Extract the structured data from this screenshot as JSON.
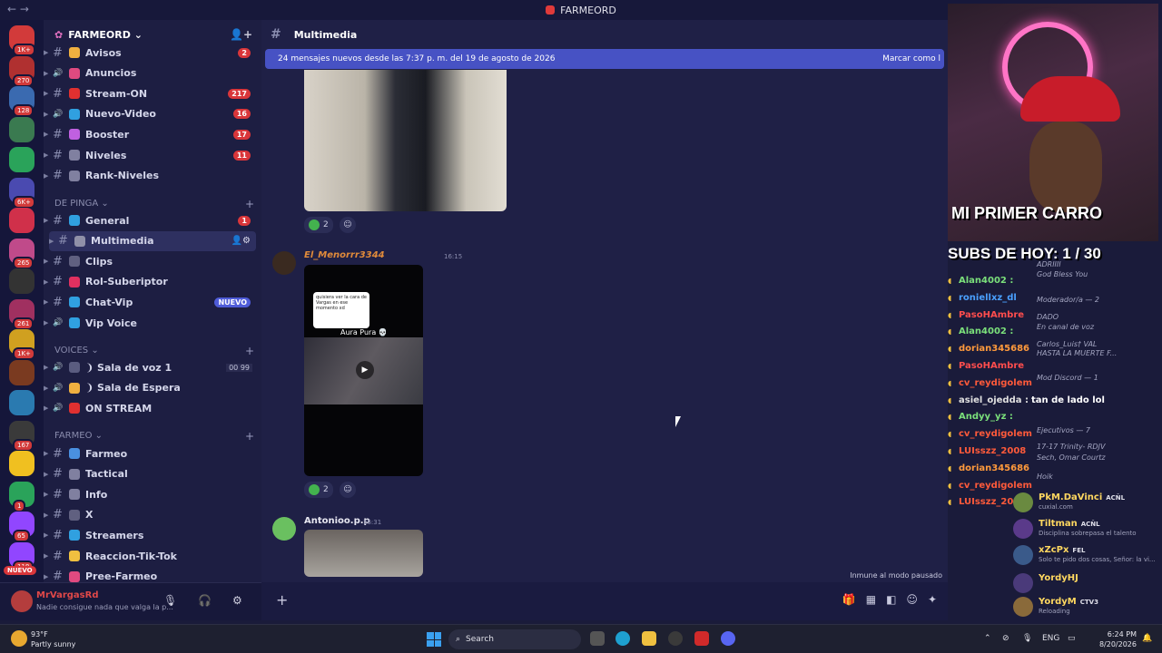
{
  "window": {
    "title": "FARMEORD",
    "nav": "← →"
  },
  "guild": {
    "name": "FARMEORD ⌄"
  },
  "servers": [
    {
      "badge": "1K+",
      "color": "#d23a3a"
    },
    {
      "badge": "270",
      "color": "#b03030"
    },
    {
      "badge": "128",
      "color": "#3a6ab0"
    },
    {
      "badge": "",
      "color": "#3a7a50"
    },
    {
      "badge": "",
      "color": "#2aa35a"
    },
    {
      "badge": "6K+",
      "color": "#4a4ab0"
    },
    {
      "badge": "",
      "color": "#d0304a"
    },
    {
      "badge": "265",
      "color": "#c04a8a"
    },
    {
      "badge": "",
      "color": "#333"
    },
    {
      "badge": "261",
      "color": "#a03060"
    },
    {
      "badge": "1K+",
      "color": "#d0a020"
    },
    {
      "badge": "",
      "color": "#7a3a20"
    },
    {
      "badge": "",
      "color": "#2a7ab0"
    },
    {
      "badge": "167",
      "color": "#3a3a3a"
    },
    {
      "badge": "",
      "color": "#f0c020"
    },
    {
      "badge": "1",
      "color": "#2aa35a"
    },
    {
      "badge": "65",
      "color": "#9146ff"
    },
    {
      "badge": "118",
      "color": "#9146ff"
    }
  ],
  "servers_new": "NUEVO",
  "channels": [
    {
      "name": "Avisos",
      "badge": "2",
      "emo": "#f0b040"
    },
    {
      "name": "Anuncios",
      "badge": "",
      "emo": "#e04a80"
    },
    {
      "name": "Stream-ON",
      "badge": "217",
      "emo": "#e03030"
    },
    {
      "name": "Nuevo-Video",
      "badge": "16",
      "emo": "#30a0e0"
    },
    {
      "name": "Booster",
      "badge": "17",
      "emo": "#c060e0"
    },
    {
      "name": "Niveles",
      "badge": "11",
      "emo": "#8080a0"
    },
    {
      "name": "Rank-Niveles",
      "badge": "",
      "emo": "#8080a0"
    }
  ],
  "cat_depinga": "DE PINGA ⌄",
  "channels2": [
    {
      "name": "General",
      "badge": "1",
      "emo": "#30a0e0"
    },
    {
      "name": "Multimedia",
      "badge": "",
      "emo": "#9090a8"
    },
    {
      "name": "Clips",
      "badge": "",
      "emo": "#606080"
    },
    {
      "name": "Rol-Suberiptor",
      "badge": "",
      "emo": "#e03060"
    },
    {
      "name": "Chat-Vip",
      "badge": "NUEVO",
      "emo": "#30a0e0"
    },
    {
      "name": "Vip Voice",
      "badge": "",
      "emo": "#30a0e0"
    }
  ],
  "cat_voices": "VOICES ⌄",
  "voices": [
    {
      "name": "❩ Sala de voz 1",
      "extra": "00  99"
    },
    {
      "name": "❩ Sala de Espera",
      "extra": ""
    },
    {
      "name": "ON STREAM",
      "extra": ""
    }
  ],
  "cat_farmeo": "FARMEO ⌄",
  "channels3": [
    {
      "name": "Farmeo"
    },
    {
      "name": "Tactical"
    },
    {
      "name": "Info"
    },
    {
      "name": "X"
    },
    {
      "name": "Streamers"
    },
    {
      "name": "Reaccion-Tik-Tok"
    },
    {
      "name": "Pree-Farmeo"
    }
  ],
  "user": {
    "name": "MrVargasRd",
    "status": "Nadie consigue nada que valga la p..."
  },
  "main": {
    "channel": "Multimedia",
    "newbar": "24 mensajes nuevos desde las 7:37 p. m. del 19 de agosto de 2026",
    "mark_read": "Marcar como l",
    "reaction_count": "2",
    "msg2_author": "El_Menorrr3344",
    "msg2_time": "16:15",
    "video_card": "quisiera ver la cara de Vargas en ese momento xd",
    "video_caption": "Aura Pura 💀",
    "msg3_author": "Antonioo.p.p",
    "msg3_time": "16:31",
    "immune": "Inmune al modo pausado"
  },
  "stream": {
    "banner": "MI PRIMER CARRO",
    "subs": "SUBS DE HOY: 1 / 30"
  },
  "chat": [
    {
      "user": "Alan4002 :",
      "msg": "",
      "color": "#7be07b"
    },
    {
      "user": "roniellxz_dl",
      "msg": "",
      "color": "#4aa0ff"
    },
    {
      "user": "PasoHAmbre",
      "msg": "",
      "color": "#ff4d4d"
    },
    {
      "user": "Alan4002 :",
      "msg": "",
      "color": "#7be07b"
    },
    {
      "user": "dorian345686",
      "msg": "",
      "color": "#ff9a3c"
    },
    {
      "user": "PasoHAmbre",
      "msg": "",
      "color": "#ff4d4d"
    },
    {
      "user": "cv_reydigolem",
      "msg": "",
      "color": "#ff5a3a"
    },
    {
      "user": "asiel_ojedda :",
      "msg": "tan de lado lol",
      "color": "#e0e0e0"
    },
    {
      "user": "Andyy_yz :",
      "msg": "",
      "color": "#7be07b"
    },
    {
      "user": "cv_reydigolem",
      "msg": "",
      "color": "#ff5a3a"
    },
    {
      "user": "LUIsszz_2008",
      "msg": "",
      "color": "#ff5a3a"
    },
    {
      "user": "dorian345686",
      "msg": "",
      "color": "#ff9a3c"
    },
    {
      "user": "cv_reydigolem",
      "msg": "",
      "color": "#ff5a3a"
    },
    {
      "user": "LUIsszz_2008",
      "msg": "",
      "color": "#ff5a3a"
    }
  ],
  "ghost": [
    {
      "text": "ADRIIII"
    },
    {
      "text": "God Bless You"
    },
    {
      "text": "Moderador/a — 2"
    },
    {
      "text": "DADO"
    },
    {
      "text": "En canal de voz"
    },
    {
      "text": "Carlos_Luis† VAL"
    },
    {
      "text": "HASTA LA MUERTE F..."
    },
    {
      "text": "Mod Discord — 1"
    },
    {
      "text": "Ejecutivos — 7"
    },
    {
      "text": "17-17 Trinity- RDJV"
    },
    {
      "text": "Sech, Omar Courtz"
    },
    {
      "text": "Hoik"
    }
  ],
  "members": [
    {
      "name": "PkM.DaVinci",
      "tag": "ACÑL",
      "status": "cuxial.com",
      "color": "#ffd860"
    },
    {
      "name": "Tiltman",
      "tag": "ACÑL",
      "status": "Disciplina sobrepasa el talento",
      "color": "#ffd860"
    },
    {
      "name": "xZcPx",
      "tag": "FEL",
      "status": "Solo te pido dos cosas, Señor: la vi...",
      "color": "#ffd860"
    },
    {
      "name": "YordyHJ",
      "tag": "",
      "status": "",
      "color": "#ffd860"
    },
    {
      "name": "YordyM",
      "tag": "CTV3",
      "status": "Reloading",
      "color": "#ffd860"
    }
  ],
  "taskbar": {
    "temp": "93°F",
    "weather": "Partly sunny",
    "search": "Search",
    "lang": "ENG",
    "time": "6:24 PM",
    "date": "8/20/2026"
  }
}
